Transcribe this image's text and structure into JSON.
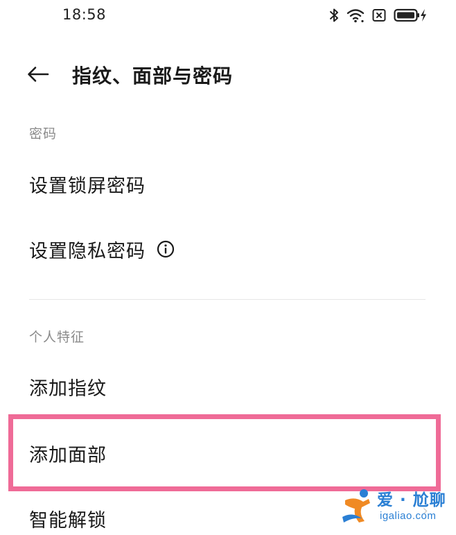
{
  "status_bar": {
    "time": "18:58",
    "icons": [
      "bluetooth-icon",
      "wifi-icon",
      "no-sim-icon",
      "battery-charging-icon"
    ]
  },
  "header": {
    "back_icon": "arrow-left-icon",
    "title": "指纹、面部与密码"
  },
  "sections": {
    "password": {
      "label": "密码",
      "items": [
        {
          "label": "设置锁屏密码"
        },
        {
          "label": "设置隐私密码",
          "icon": "info-icon"
        }
      ]
    },
    "personal": {
      "label": "个人特征",
      "items": [
        {
          "label": "添加指纹"
        },
        {
          "label": "添加面部",
          "highlighted": true
        },
        {
          "label": "智能解锁"
        }
      ]
    }
  },
  "highlight_color": "#ef6b97",
  "watermark": {
    "top_text": "爱 · 尬聊",
    "bottom_text": "igaliao.com"
  }
}
